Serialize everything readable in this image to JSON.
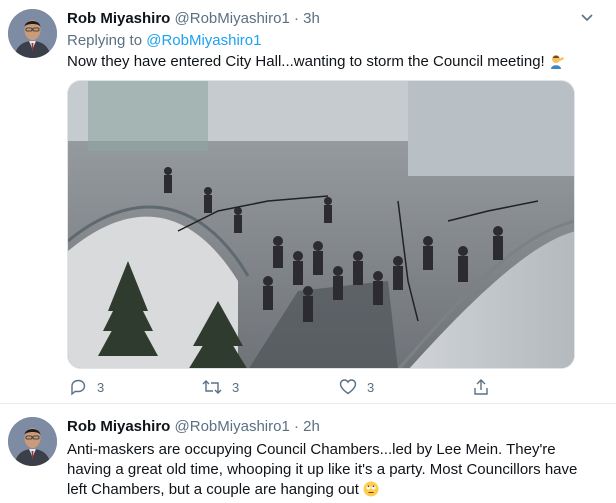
{
  "tweets": [
    {
      "author_name": "Rob Miyashiro",
      "author_handle": "@RobMiyashiro1",
      "dot": "·",
      "time": "3h",
      "replying_prefix": "Replying to",
      "replying_to": "@RobMiyashiro1",
      "text": "Now they have entered City Hall...wanting to storm the Council meeting!",
      "emoji": "man-facepalming-emoji",
      "actions": {
        "replies": "3",
        "retweets": "3",
        "likes": "3"
      }
    },
    {
      "author_name": "Rob Miyashiro",
      "author_handle": "@RobMiyashiro1",
      "dot": "·",
      "time": "2h",
      "text": "Anti-maskers are occupying Council Chambers...led by Lee Mein. They're having a great old time, whooping it up like it's a party. Most Councillors have left Chambers, but a couple are hanging out",
      "emoji": "face-with-rolling-eyes-emoji"
    }
  ],
  "icons": {
    "reply": "reply-icon",
    "retweet": "retweet-icon",
    "like": "heart-icon",
    "share": "share-icon",
    "menu": "chevron-down-icon"
  },
  "colors": {
    "accent": "#1da1f2",
    "muted": "#5b7083",
    "text": "#0f1419"
  }
}
